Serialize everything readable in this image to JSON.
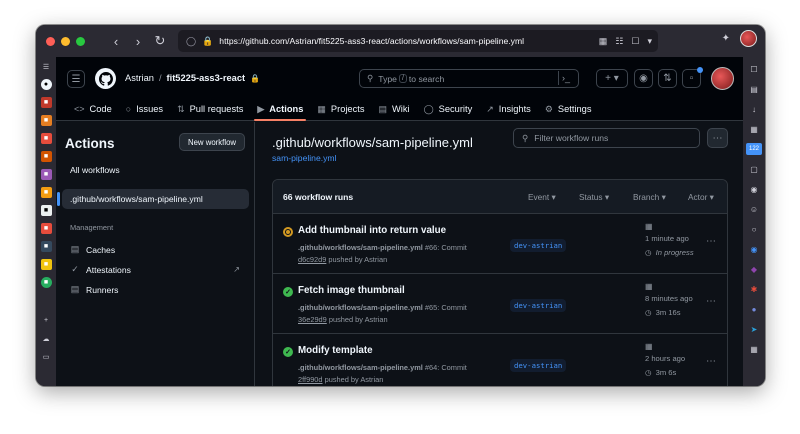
{
  "browser": {
    "url": "https://github.com/Astrian/fit5225-ass3-react/actions/workflows/sam-pipeline.yml",
    "badge_count": "122"
  },
  "header": {
    "owner": "Astrian",
    "separator": "/",
    "repo": "fit5225-ass3-react",
    "search_prefix": "Type",
    "search_key": "/",
    "search_suffix": "to search"
  },
  "tabs": [
    {
      "label": "Code",
      "icon": "code-icon"
    },
    {
      "label": "Issues",
      "icon": "issue-icon"
    },
    {
      "label": "Pull requests",
      "icon": "pull-request-icon"
    },
    {
      "label": "Actions",
      "icon": "play-icon"
    },
    {
      "label": "Projects",
      "icon": "table-icon"
    },
    {
      "label": "Wiki",
      "icon": "book-icon"
    },
    {
      "label": "Security",
      "icon": "shield-icon"
    },
    {
      "label": "Insights",
      "icon": "graph-icon"
    },
    {
      "label": "Settings",
      "icon": "gear-icon"
    }
  ],
  "sidebar": {
    "title": "Actions",
    "new_workflow": "New workflow",
    "items": [
      "All workflows",
      ".github/workflows/sam-pipeline.yml"
    ],
    "management_label": "Management",
    "management": [
      {
        "label": "Caches",
        "icon": "database-icon"
      },
      {
        "label": "Attestations",
        "icon": "verified-icon"
      },
      {
        "label": "Runners",
        "icon": "server-icon"
      }
    ]
  },
  "main": {
    "title": ".github/workflows/sam-pipeline.yml",
    "file_link": "sam-pipeline.yml",
    "filter_placeholder": "Filter workflow runs",
    "runs_count": "66 workflow runs",
    "filters": [
      "Event",
      "Status",
      "Branch",
      "Actor"
    ],
    "runs": [
      {
        "title": "Add thumbnail into return value",
        "workflow": ".github/workflows/sam-pipeline.yml",
        "run_no": "#66: Commit",
        "commit": "d6c92d9",
        "pushed_by": "pushed by Astrian",
        "branch": "dev-astrian",
        "when": "1 minute ago",
        "duration": "In progress",
        "status": "in-progress",
        "status_color": "#d29922"
      },
      {
        "title": "Fetch image thumbnail",
        "workflow": ".github/workflows/sam-pipeline.yml",
        "run_no": "#65: Commit",
        "commit": "36e29d9",
        "pushed_by": "pushed by Astrian",
        "branch": "dev-astrian",
        "when": "8 minutes ago",
        "duration": "3m 16s",
        "status": "success",
        "status_color": "#3fb950"
      },
      {
        "title": "Modify template",
        "workflow": ".github/workflows/sam-pipeline.yml",
        "run_no": "#64: Commit",
        "commit": "2ff990d",
        "pushed_by": "pushed by Astrian",
        "branch": "dev-astrian",
        "when": "2 hours ago",
        "duration": "3m 6s",
        "status": "success",
        "status_color": "#3fb950"
      }
    ]
  }
}
